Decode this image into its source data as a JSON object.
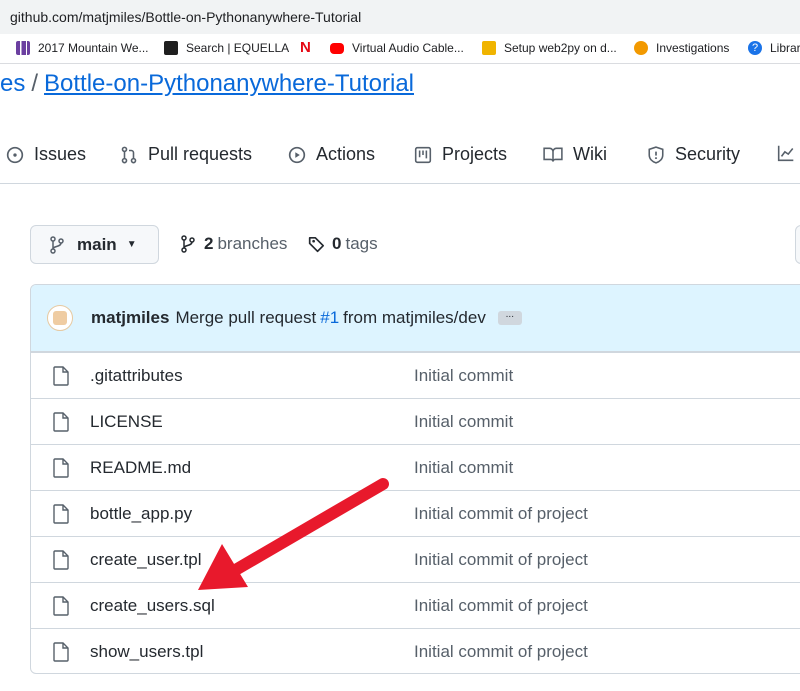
{
  "browser": {
    "url": "github.com/matjmiles/Bottle-on-Pythonanywhere-Tutorial",
    "bookmarks": [
      {
        "label": "2017 Mountain We...",
        "color": "#6b3fa0"
      },
      {
        "label": "Search | EQUELLA",
        "color": "#1f1f1f"
      },
      {
        "label": "",
        "color": "#e50914"
      },
      {
        "label": "Virtual Audio Cable...",
        "color": "#ff0000"
      },
      {
        "label": "Setup web2py on d...",
        "color": "#f0b400"
      },
      {
        "label": "Investigations",
        "color": "#f29900"
      },
      {
        "label": "Librar",
        "color": "#1a73e8"
      }
    ]
  },
  "repo": {
    "owner_fragment": "es",
    "separator": "/",
    "name": "Bottle-on-Pythonanywhere-Tutorial"
  },
  "tabs": [
    {
      "label": "Issues",
      "icon": "issue-opened-icon"
    },
    {
      "label": "Pull requests",
      "icon": "git-pull-request-icon"
    },
    {
      "label": "Actions",
      "icon": "play-icon"
    },
    {
      "label": "Projects",
      "icon": "project-table-icon"
    },
    {
      "label": "Wiki",
      "icon": "book-icon"
    },
    {
      "label": "Security",
      "icon": "shield-icon"
    }
  ],
  "branch": {
    "current": "main",
    "branches_count": "2",
    "branches_label": "branches",
    "tags_count": "0",
    "tags_label": "tags"
  },
  "commit": {
    "author": "matjmiles",
    "message_prefix": "Merge pull request",
    "pr_link": "#1",
    "message_suffix": "from matjmiles/dev",
    "ellipsis": "..."
  },
  "files": [
    {
      "name": ".gitattributes",
      "message": "Initial commit"
    },
    {
      "name": "LICENSE",
      "message": "Initial commit"
    },
    {
      "name": "README.md",
      "message": "Initial commit"
    },
    {
      "name": "bottle_app.py",
      "message": "Initial commit of project"
    },
    {
      "name": "create_user.tpl",
      "message": "Initial commit of project"
    },
    {
      "name": "create_users.sql",
      "message": "Initial commit of project"
    },
    {
      "name": "show_users.tpl",
      "message": "Initial commit of project"
    }
  ],
  "annotation": {
    "arrow_color": "#e8192c",
    "points_to": "create_users.sql"
  }
}
